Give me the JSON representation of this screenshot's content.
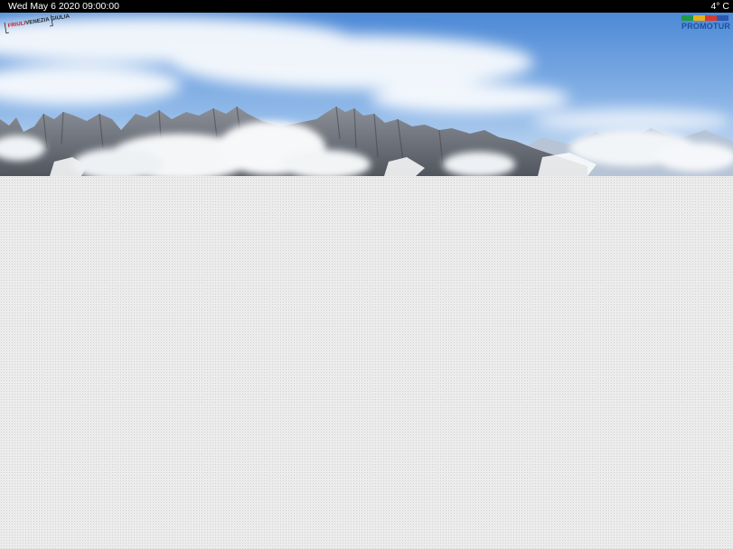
{
  "overlay": {
    "timestamp": "Wed May 6 2020 09:00:00",
    "temperature": "4° C"
  },
  "logos": {
    "left": {
      "icon": "friuli-venezia-giulia-logo",
      "text_a": "FRIULI",
      "text_b": "VENEZIA GIULIA"
    },
    "right": {
      "icon": "promotur-logo",
      "text": "PROMOTUR",
      "colors": [
        "#1f9a4a",
        "#e5b020",
        "#d63a2e",
        "#2a58b0"
      ]
    }
  },
  "scene": {
    "sky_top": "#4f8bd8",
    "sky_bottom": "#cfe2f5",
    "mountain": "#7d838c",
    "cloud": "#f4f6f8"
  }
}
